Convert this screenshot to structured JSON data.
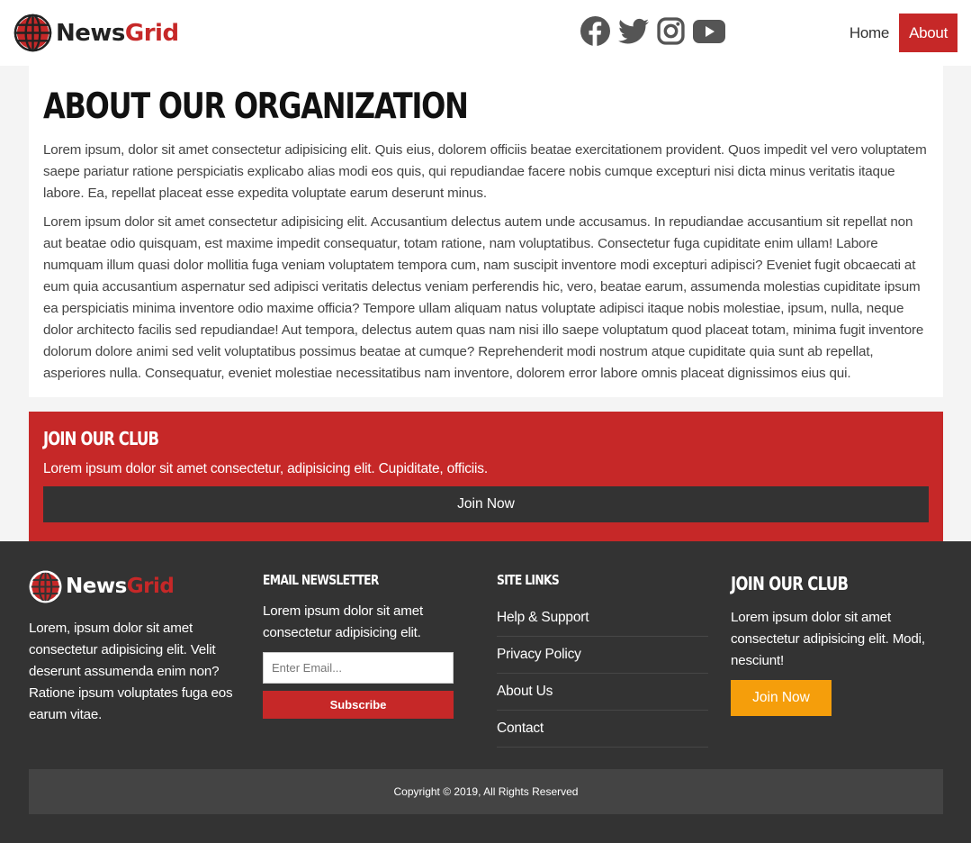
{
  "brand": {
    "news": "News",
    "grid": "Grid",
    "accent": "#c62828"
  },
  "social": [
    "facebook-icon",
    "twitter-icon",
    "instagram-icon",
    "youtube-icon"
  ],
  "nav": {
    "home": "Home",
    "about": "About"
  },
  "about": {
    "title": "ABOUT OUR ORGANIZATION",
    "p1": "Lorem ipsum, dolor sit amet consectetur adipisicing elit. Quis eius, dolorem officiis beatae exercitationem provident. Quos impedit vel vero voluptatem saepe pariatur ratione perspiciatis explicabo alias modi eos quis, qui repudiandae facere nobis cumque excepturi nisi dicta minus veritatis itaque labore. Ea, repellat placeat esse expedita voluptate earum deserunt minus.",
    "p2": "Lorem ipsum dolor sit amet consectetur adipisicing elit. Accusantium delectus autem unde accusamus. In repudiandae accusantium sit repellat non aut beatae odio quisquam, est maxime impedit consequatur, totam ratione, nam voluptatibus. Consectetur fuga cupiditate enim ullam! Labore numquam illum quasi dolor mollitia fuga veniam voluptatem tempora cum, nam suscipit inventore modi excepturi adipisci? Eveniet fugit obcaecati at eum quia accusantium aspernatur sed adipisci veritatis delectus veniam perferendis hic, vero, beatae earum, assumenda molestias cupiditate ipsum ea perspiciatis minima inventore odio maxime officia? Tempore ullam aliquam natus voluptate adipisci itaque nobis molestiae, ipsum, nulla, neque dolor architecto facilis sed repudiandae! Aut tempora, delectus autem quas nam nisi illo saepe voluptatum quod placeat totam, minima fugit inventore dolorum dolore animi sed velit voluptatibus possimus beatae at cumque? Reprehenderit modi nostrum atque cupiditate quia sunt ab repellat, asperiores nulla. Consequatur, eveniet molestiae necessitatibus nam inventore, dolorem error labore omnis placeat dignissimos eius qui."
  },
  "club": {
    "title": "JOIN OUR CLUB",
    "text": "Lorem ipsum dolor sit amet consectetur, adipisicing elit. Cupiditate, officiis.",
    "button": "Join Now"
  },
  "footer": {
    "about_text": "Lorem, ipsum dolor sit amet consectetur adipisicing elit. Velit deserunt assumenda enim non? Ratione ipsum voluptates fuga eos earum vitae.",
    "newsletter": {
      "title": "EMAIL NEWSLETTER",
      "text": "Lorem ipsum dolor sit amet consectetur adipisicing elit.",
      "placeholder": "Enter Email...",
      "button": "Subscribe"
    },
    "site_links": {
      "title": "SITE LINKS",
      "items": [
        "Help & Support",
        "Privacy Policy",
        "About Us",
        "Contact"
      ]
    },
    "club": {
      "title": "JOIN OUR CLUB",
      "text": "Lorem ipsum dolor sit amet consectetur adipisicing elit. Modi, nesciunt!",
      "button": "Join Now",
      "button_color": "#f59e0b"
    },
    "copyright": "Copyright © 2019, All Rights Reserved"
  }
}
